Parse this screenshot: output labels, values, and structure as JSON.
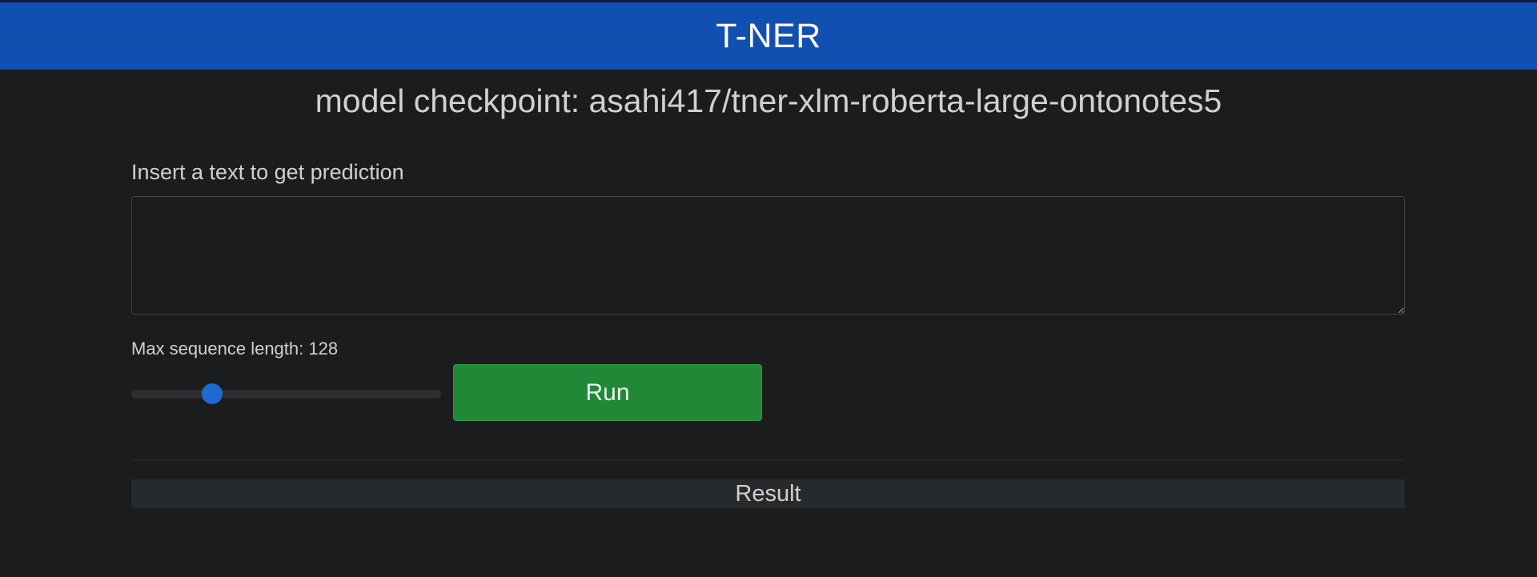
{
  "header": {
    "title": "T-NER"
  },
  "main": {
    "subtitle": "model checkpoint: asahi417/tner-xlm-roberta-large-ontonotes5",
    "input_label": "Insert a text to get prediction",
    "input_value": "",
    "input_placeholder": "",
    "slider_label": "Max sequence length: 128",
    "slider": {
      "value": 128,
      "fraction": 0.26
    },
    "run_label": "Run",
    "result_label": "Result"
  },
  "colors": {
    "header_background": "#114fb1",
    "page_background": "#1b1c1e",
    "run_button": "#218838",
    "slider_thumb": "#1e6ad0",
    "result_background": "#262a2d"
  }
}
